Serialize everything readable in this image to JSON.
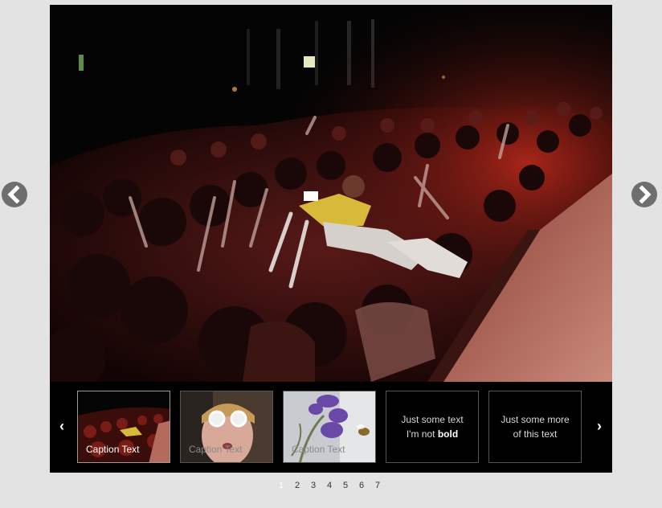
{
  "slider": {
    "main_image": "concert-crowd-surfing-photo",
    "thumbnails": [
      {
        "caption": "Caption Text",
        "image": "concert-crowd-thumbnail",
        "active": true
      },
      {
        "caption": "Caption Text",
        "image": "child-with-glasses-thumbnail",
        "active": false
      },
      {
        "caption": "Caption Text",
        "image": "purple-flower-bee-thumbnail",
        "active": false
      }
    ],
    "text_thumbs": [
      {
        "line1": "Just some text",
        "line2_prefix": "I'm not ",
        "line2_bold": "bold"
      },
      {
        "line1": "Just some more",
        "line2": "of this text"
      }
    ],
    "strip_prev": "‹",
    "strip_next": "›"
  },
  "pager": {
    "pages": [
      "1",
      "2",
      "3",
      "4",
      "5",
      "6",
      "7"
    ],
    "current": "1"
  },
  "colors": {
    "background": "#e3e3e3",
    "frame": "#000000",
    "nav_arrow": "#6e6e6e"
  }
}
